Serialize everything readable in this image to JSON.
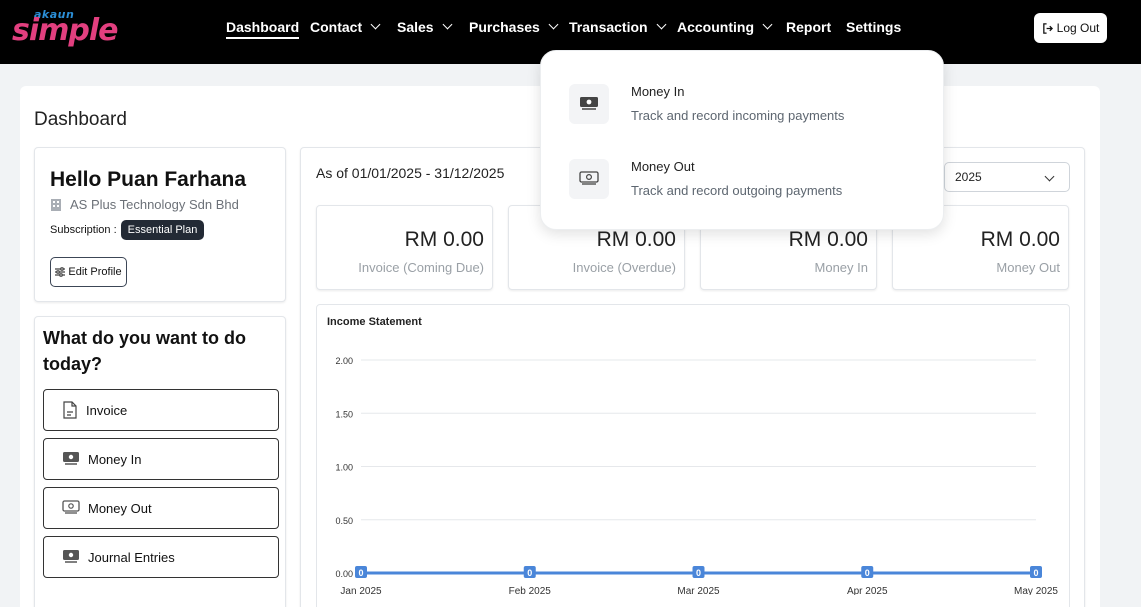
{
  "app": {
    "logo_small": "akaun",
    "logo_big": "simple"
  },
  "nav": {
    "items": [
      {
        "label": "Dashboard"
      },
      {
        "label": "Contact"
      },
      {
        "label": "Sales"
      },
      {
        "label": "Purchases"
      },
      {
        "label": "Transaction"
      },
      {
        "label": "Accounting"
      },
      {
        "label": "Report"
      },
      {
        "label": "Settings"
      }
    ],
    "logout_label": "Log Out"
  },
  "page": {
    "title": "Dashboard"
  },
  "profile": {
    "greeting": "Hello Puan Farhana",
    "company": "AS Plus Technology Sdn Bhd",
    "subscription_label": "Subscription :",
    "plan": "Essential Plan",
    "edit_label": "Edit Profile"
  },
  "todo": {
    "title": "What do you want to do today?",
    "actions": [
      {
        "label": "Invoice"
      },
      {
        "label": "Money In"
      },
      {
        "label": "Money Out"
      },
      {
        "label": "Journal Entries"
      }
    ]
  },
  "summary": {
    "period": "As of 01/01/2025 - 31/12/2025",
    "year": "2025",
    "stats": [
      {
        "amount": "RM 0.00",
        "label": "Invoice (Coming Due)"
      },
      {
        "amount": "RM 0.00",
        "label": "Invoice (Overdue)"
      },
      {
        "amount": "RM 0.00",
        "label": "Money In"
      },
      {
        "amount": "RM 0.00",
        "label": "Money Out"
      }
    ]
  },
  "dropdown": {
    "items": [
      {
        "title": "Money In",
        "description": "Track and record incoming payments"
      },
      {
        "title": "Money Out",
        "description": "Track and record outgoing payments"
      }
    ]
  },
  "colors": {
    "line": "#4a86d9",
    "nav_bg": "#000000",
    "badge_bg": "#232a35"
  },
  "chart_data": {
    "type": "line",
    "title": "Income Statement",
    "categories": [
      "Jan 2025",
      "Feb 2025",
      "Mar 2025",
      "Apr 2025",
      "May 2025"
    ],
    "series": [
      {
        "values": [
          0,
          0,
          0,
          0,
          0
        ]
      }
    ],
    "data_labels": [
      "0",
      "0",
      "0",
      "0",
      "0"
    ],
    "y_ticks": [
      "2.00",
      "1.50",
      "1.00",
      "0.50",
      "0.00"
    ],
    "ylim": [
      0,
      2
    ],
    "grid": true
  }
}
